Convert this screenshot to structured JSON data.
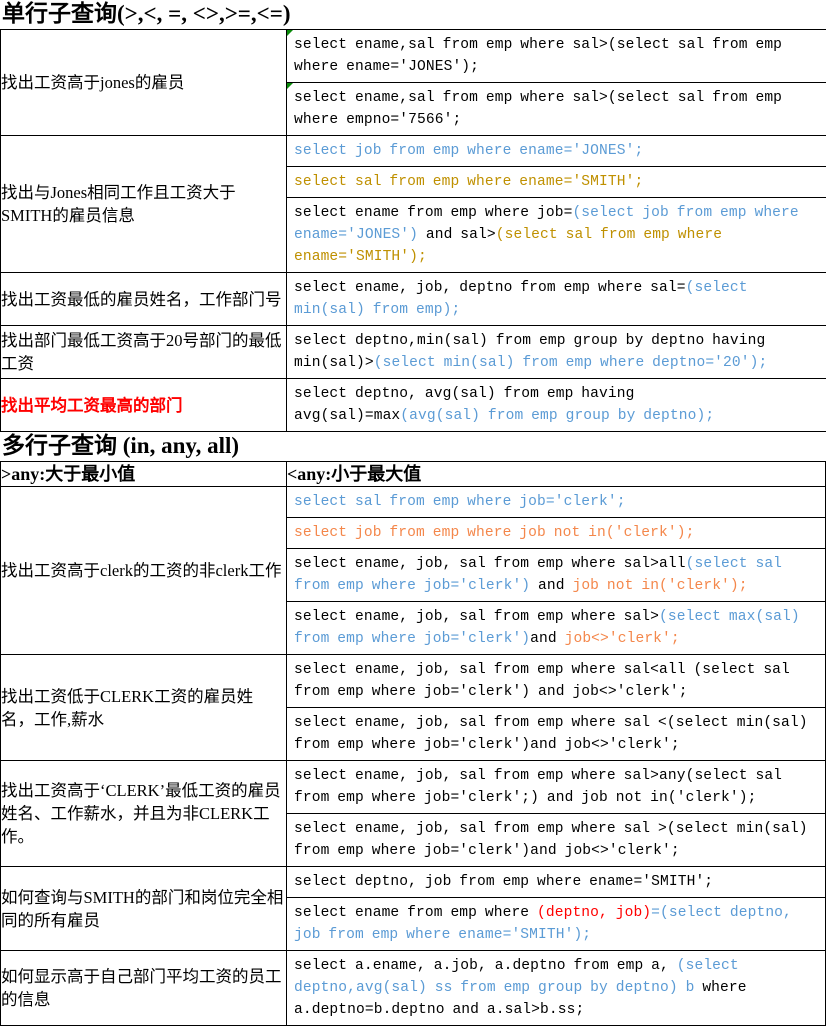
{
  "doc": {
    "section1_title": "单行子查询(>,<, =, <>,>=,<=)",
    "section2_title": "多行子查询 (in, any, all)"
  },
  "any_header": {
    "left": ">any:大于最小值",
    "right": "<any:小于最大值"
  },
  "section1_rows": [
    {
      "label": "找出工资高于jones的雇员",
      "label_color": "black",
      "sql": [
        {
          "mark": true,
          "parts": [
            {
              "t": "select ename,sal from emp where sal>(select sal from emp where ename='JONES');",
              "c": "black"
            }
          ]
        },
        {
          "mark": true,
          "parts": [
            {
              "t": "select ename,sal from emp where sal>(select sal from emp where empno='7566';",
              "c": "black"
            }
          ]
        }
      ]
    },
    {
      "label": "找出与Jones相同工作且工资大于SMITH的雇员信息",
      "label_color": "black",
      "sql": [
        {
          "mark": false,
          "parts": [
            {
              "t": "select job from emp where ename='JONES';",
              "c": "blue"
            }
          ]
        },
        {
          "mark": false,
          "parts": [
            {
              "t": "select sal from emp where ename='SMITH';",
              "c": "gold"
            }
          ]
        },
        {
          "mark": false,
          "parts": [
            {
              "t": "select ename from emp where job=",
              "c": "black"
            },
            {
              "t": "(select job from emp where ename='JONES')",
              "c": "blue"
            },
            {
              "t": " and sal>",
              "c": "black"
            },
            {
              "t": "(select sal from emp where ename='SMITH');",
              "c": "gold"
            }
          ]
        }
      ]
    },
    {
      "label": "找出工资最低的雇员姓名，工作部门号",
      "label_color": "black",
      "sql": [
        {
          "mark": false,
          "parts": [
            {
              "t": "select ename, job, deptno from emp where sal=",
              "c": "black"
            },
            {
              "t": "(select min(sal) from emp);",
              "c": "blue"
            }
          ]
        }
      ]
    },
    {
      "label": "找出部门最低工资高于20号部门的最低工资",
      "label_color": "black",
      "sql": [
        {
          "mark": false,
          "parts": [
            {
              "t": "select deptno,min(sal) from emp group by deptno having min(sal)>",
              "c": "black"
            },
            {
              "t": "(select min(sal) from emp where deptno='20');",
              "c": "blue"
            }
          ]
        }
      ]
    },
    {
      "label": "找出平均工资最高的部门",
      "label_color": "red",
      "sql": [
        {
          "mark": false,
          "parts": [
            {
              "t": "select deptno, avg(sal) from emp having avg(sal)=max",
              "c": "black"
            },
            {
              "t": "(avg(sal) from emp group by deptno);",
              "c": "blue"
            }
          ]
        }
      ]
    }
  ],
  "section2_rows": [
    {
      "label": "找出工资高于clerk的工资的非clerk工作",
      "label_color": "black",
      "sql": [
        {
          "mark": false,
          "parts": [
            {
              "t": "select sal from emp where job='clerk';",
              "c": "blue"
            }
          ]
        },
        {
          "mark": false,
          "parts": [
            {
              "t": "select job from emp where job not in('clerk');",
              "c": "orange"
            }
          ]
        },
        {
          "mark": false,
          "parts": [
            {
              "t": "select ename, job, sal from emp where sal>all",
              "c": "black"
            },
            {
              "t": "(select sal from emp where job='clerk')",
              "c": "blue"
            },
            {
              "t": " and ",
              "c": "black"
            },
            {
              "t": "job not in('clerk');",
              "c": "orange"
            }
          ]
        },
        {
          "mark": false,
          "parts": [
            {
              "t": "select ename, job, sal from emp where sal>",
              "c": "black"
            },
            {
              "t": "(select max(sal) from emp where job='clerk')",
              "c": "blue"
            },
            {
              "t": "and ",
              "c": "black"
            },
            {
              "t": "job<>'clerk';",
              "c": "orange"
            }
          ]
        }
      ]
    },
    {
      "label": "找出工资低于CLERK工资的雇员姓名，工作,薪水",
      "label_color": "black",
      "sql": [
        {
          "mark": false,
          "parts": [
            {
              "t": "select ename, job, sal from emp where sal<all (select sal from emp where job='clerk') and job<>'clerk';",
              "c": "black"
            }
          ]
        },
        {
          "mark": false,
          "parts": [
            {
              "t": "select ename, job, sal from emp where sal <(select min(sal) from emp where job='clerk')and job<>'clerk';",
              "c": "black"
            }
          ]
        }
      ]
    },
    {
      "label": "找出工资高于‘CLERK’最低工资的雇员姓名、工作薪水，并且为非CLERK工作。",
      "label_color": "black",
      "sql": [
        {
          "mark": false,
          "parts": [
            {
              "t": "select ename, job, sal from emp where sal>any(select sal from emp where job='clerk';) and job not in('clerk');",
              "c": "black"
            }
          ]
        },
        {
          "mark": false,
          "parts": [
            {
              "t": "select ename, job, sal from emp where sal >(select min(sal) from emp where job='clerk')and job<>'clerk';",
              "c": "black"
            }
          ]
        }
      ]
    },
    {
      "label": "如何查询与SMITH的部门和岗位完全相同的所有雇员",
      "label_color": "black",
      "sql": [
        {
          "mark": false,
          "parts": [
            {
              "t": "select deptno, job from emp where ename='SMITH';",
              "c": "black"
            }
          ]
        },
        {
          "mark": false,
          "parts": [
            {
              "t": "select ename from emp where ",
              "c": "black"
            },
            {
              "t": "(deptno, job)",
              "c": "red"
            },
            {
              "t": "=(select deptno, job from emp where ename='SMITH');",
              "c": "blue"
            }
          ]
        }
      ]
    },
    {
      "label": "如何显示高于自己部门平均工资的员工的信息",
      "label_color": "black",
      "sql": [
        {
          "mark": false,
          "parts": [
            {
              "t": "select a.ename, a.job, a.deptno from emp a, ",
              "c": "black"
            },
            {
              "t": "(select deptno,avg(sal) ss from emp group by deptno) b ",
              "c": "blue"
            },
            {
              "t": "where a.deptno=b.deptno and a.sal>b.ss;",
              "c": "black"
            }
          ]
        }
      ]
    }
  ]
}
